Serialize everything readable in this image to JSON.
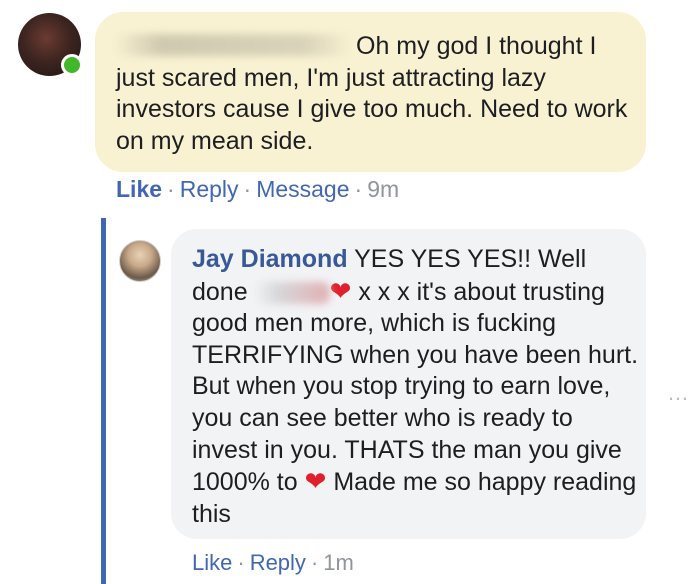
{
  "comment": {
    "text_line1": "Oh my god I thought I",
    "text_rest": "just scared men, I'm just attracting lazy investors cause I give too much. Need to work on my mean side.",
    "actions": {
      "like": "Like",
      "reply": "Reply",
      "message": "Message",
      "time": "9m"
    }
  },
  "reply": {
    "author": "Jay Diamond",
    "text_part1": "YES YES YES!! Well done",
    "heart1": "❤",
    "text_part2": "x x x it's about trusting good men more, which is fucking TERRIFYING when you have been hurt. But when you stop trying to earn love, you can see better who is ready to invest in you. THATS the man you give 1000% to",
    "heart2": "❤",
    "text_part3": "Made me so happy reading this",
    "actions": {
      "like": "Like",
      "reply": "Reply",
      "time": "1m"
    }
  },
  "more_menu_icon": "…",
  "colors": {
    "link": "#4267b2",
    "author": "#385898",
    "highlight_bubble": "#f9f2d2",
    "reply_bubble": "#f2f3f5",
    "presence": "#42b72a",
    "thread_line": "#4267b2"
  }
}
